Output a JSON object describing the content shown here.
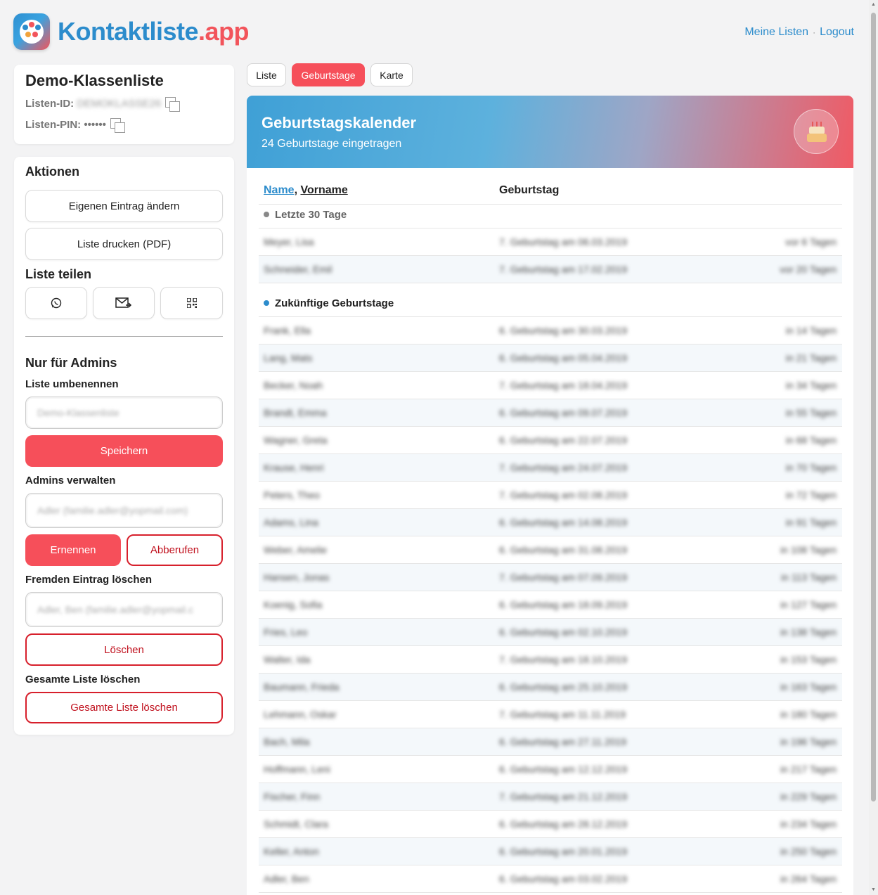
{
  "app": {
    "brand_part1": "Kontaktliste",
    "brand_part2": ".app",
    "nav": [
      "Meine Listen",
      "Logout"
    ],
    "nav_separator": "·"
  },
  "list_card": {
    "title": "Demo-Klassenliste",
    "id_label": "Listen-ID:",
    "id_value": "DEMOKLASSE26",
    "pin_label": "Listen-PIN:",
    "pin_value": "••••••"
  },
  "actions": {
    "title": "Aktionen",
    "edit_own": "Eigenen Eintrag ändern",
    "print_pdf": "Liste drucken (PDF)",
    "share_title": "Liste teilen",
    "share_icons": [
      "whatsapp-icon",
      "email-share-icon",
      "qr-code-icon"
    ]
  },
  "admin": {
    "title": "Nur für Admins",
    "rename_label": "Liste umbenennen",
    "rename_value": "Demo-Klassenliste",
    "save": "Speichern",
    "manage_label": "Admins verwalten",
    "manage_value": "Adler (familie.adler@yopmail.com)",
    "appoint": "Ernennen",
    "revoke": "Abberufen",
    "delete_entry_label": "Fremden Eintrag löschen",
    "delete_entry_value": "Adler, Ben (familie.adler@yopmail.c",
    "delete": "Löschen",
    "delete_all_label": "Gesamte Liste löschen",
    "delete_all": "Gesamte Liste löschen"
  },
  "tabs": [
    {
      "label": "Liste",
      "active": false
    },
    {
      "label": "Geburtstage",
      "active": true
    },
    {
      "label": "Karte",
      "active": false
    }
  ],
  "calendar": {
    "title": "Geburtstagskalender",
    "subtitle": "24 Geburtstage eingetragen",
    "col_name_a": "Name",
    "col_name_sep": ", ",
    "col_name_b": "Vorname",
    "col_birthday": "Geburtstag",
    "group_past": "Letzte 30 Tage",
    "group_future": "Zukünftige Geburtstage",
    "colors": {
      "accent": "#2c8ccc",
      "red": "#f64f5a",
      "past_dot": "#888888",
      "future_dot": "#2c8ccc"
    },
    "past_rows": [
      {
        "name": "Meyer, Lisa",
        "birthday": "7. Geburtstag  am 06.03.2019",
        "rel": "vor 6 Tagen"
      },
      {
        "name": "Schneider, Emil",
        "birthday": "7. Geburtstag  am 17.02.2019",
        "rel": "vor 20 Tagen"
      }
    ],
    "future_rows": [
      {
        "name": "Frank, Ella",
        "birthday": "6. Geburtstag  am 30.03.2019",
        "rel": "in 14 Tagen"
      },
      {
        "name": "Lang, Mats",
        "birthday": "6. Geburtstag  am 05.04.2019",
        "rel": "in 21 Tagen"
      },
      {
        "name": "Becker, Noah",
        "birthday": "7. Geburtstag  am 18.04.2019",
        "rel": "in 34 Tagen"
      },
      {
        "name": "Brandt, Emma",
        "birthday": "6. Geburtstag  am 09.07.2019",
        "rel": "in 55 Tagen"
      },
      {
        "name": "Wagner, Greta",
        "birthday": "6. Geburtstag  am 22.07.2019",
        "rel": "in 68 Tagen"
      },
      {
        "name": "Krause, Henri",
        "birthday": "7. Geburtstag  am 24.07.2019",
        "rel": "in 70 Tagen"
      },
      {
        "name": "Peters, Theo",
        "birthday": "7. Geburtstag  am 02.08.2019",
        "rel": "in 72 Tagen"
      },
      {
        "name": "Adams, Lina",
        "birthday": "6. Geburtstag  am 14.08.2019",
        "rel": "in 91 Tagen"
      },
      {
        "name": "Weber, Amelie",
        "birthday": "6. Geburtstag  am 31.08.2019",
        "rel": "in 108 Tagen"
      },
      {
        "name": "Hansen, Jonas",
        "birthday": "7. Geburtstag  am 07.09.2019",
        "rel": "in 113 Tagen"
      },
      {
        "name": "Koenig, Sofia",
        "birthday": "6. Geburtstag  am 18.09.2019",
        "rel": "in 127 Tagen"
      },
      {
        "name": "Fries, Leo",
        "birthday": "6. Geburtstag  am 02.10.2019",
        "rel": "in 138 Tagen"
      },
      {
        "name": "Walter, Ida",
        "birthday": "7. Geburtstag  am 18.10.2019",
        "rel": "in 153 Tagen"
      },
      {
        "name": "Baumann, Frieda",
        "birthday": "6. Geburtstag  am 25.10.2019",
        "rel": "in 163 Tagen"
      },
      {
        "name": "Lehmann, Oskar",
        "birthday": "7. Geburtstag  am 11.11.2019",
        "rel": "in 180 Tagen"
      },
      {
        "name": "Bach, Mila",
        "birthday": "6. Geburtstag  am 27.11.2019",
        "rel": "in 196 Tagen"
      },
      {
        "name": "Hoffmann, Leni",
        "birthday": "6. Geburtstag  am 12.12.2019",
        "rel": "in 217 Tagen"
      },
      {
        "name": "Fischer, Finn",
        "birthday": "7. Geburtstag  am 21.12.2019",
        "rel": "in 229 Tagen"
      },
      {
        "name": "Schmidt, Clara",
        "birthday": "6. Geburtstag  am 28.12.2019",
        "rel": "in 234 Tagen"
      },
      {
        "name": "Keller, Anton",
        "birthday": "6. Geburtstag  am 20.01.2019",
        "rel": "in 250 Tagen"
      },
      {
        "name": "Adler, Ben",
        "birthday": "6. Geburtstag  am 03.02.2019",
        "rel": "in 264 Tagen"
      }
    ]
  }
}
